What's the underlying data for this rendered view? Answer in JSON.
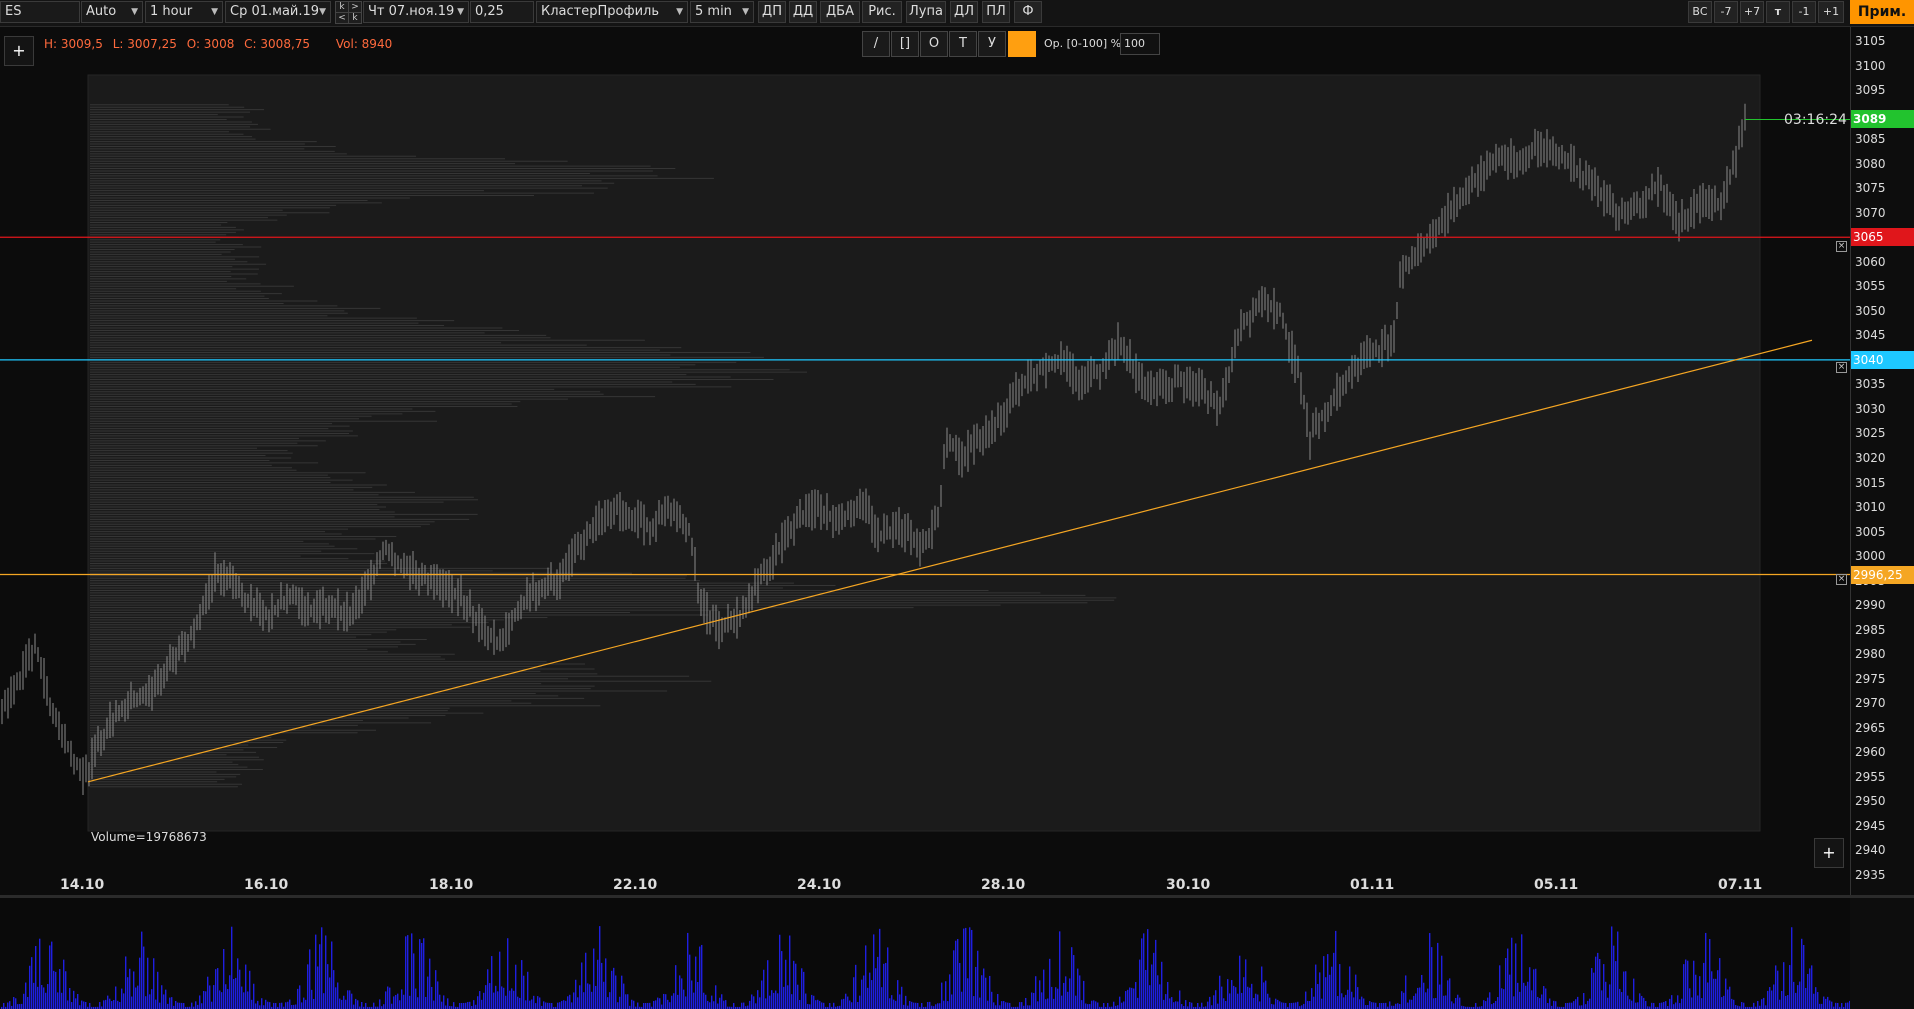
{
  "toolbar": {
    "symbol": "ES",
    "scale": "Auto",
    "timeframe": "1 hour",
    "date_from": "Ср 01.май.19",
    "date_to": "Чт 07.ноя.19",
    "step_top_left": "k",
    "step_top_right": ">",
    "step_bot_left": "<",
    "step_bot_right": "k",
    "tick": "0,25",
    "mode": "КластерПрофиль",
    "interval": "5 min",
    "buttons": [
      "ДП",
      "ДД",
      "ДБА",
      "Рис.",
      "Лупа",
      "ДЛ",
      "ПЛ",
      "Ф"
    ],
    "right_buttons": [
      "ВС",
      "-7",
      "+7",
      "т",
      "-1",
      "+1"
    ],
    "prim_label": "Прим."
  },
  "info": {
    "high": "H: 3009,5",
    "low": "L: 3007,25",
    "open": "O: 3008",
    "close": "C: 3008,75",
    "volume": "Vol: 8940"
  },
  "draw_tools": {
    "tools": [
      "/",
      "[]",
      "O",
      "T",
      "У"
    ],
    "color": "#ff9f10",
    "opacity_label": "Ор. [0-100] %:",
    "opacity_value": "100"
  },
  "profile_volume_label": "Volume=19768673",
  "timer": "03:16:24",
  "price_axis": {
    "labels": [
      "3105",
      "3100",
      "3095",
      "3090",
      "3085",
      "3080",
      "3075",
      "3070",
      "3065",
      "3060",
      "3055",
      "3050",
      "3045",
      "3040",
      "3035",
      "3030",
      "3025",
      "3020",
      "3015",
      "3010",
      "3005",
      "3000",
      "2995",
      "2990",
      "2985",
      "2980",
      "2975",
      "2970",
      "2965",
      "2960",
      "2955",
      "2950",
      "2945",
      "2940",
      "2935"
    ],
    "tags": [
      {
        "label": "3089",
        "bg": "#22c32e",
        "fg": "#ffffff"
      },
      {
        "label": "3065",
        "bg": "#e0161b",
        "fg": "#ffffff"
      },
      {
        "label": "3040",
        "bg": "#1ec8ff",
        "fg": "#ffffff"
      },
      {
        "label": "2996,25",
        "bg": "#f5a623",
        "fg": "#ffffff"
      }
    ]
  },
  "time_axis": [
    "14.10",
    "16.10",
    "18.10",
    "22.10",
    "24.10",
    "28.10",
    "30.10",
    "01.11",
    "05.11",
    "07.11"
  ],
  "colors": {
    "red_level": "#e0161b",
    "blue_level": "#1ec8ff",
    "orange_level": "#f5a623",
    "trendline": "#f5a623",
    "current_price": "#22c32e",
    "volume_bars": "#1f1fe0"
  },
  "chart_data": {
    "type": "bar",
    "series": [
      {
        "name": "ES",
        "values": []
      }
    ],
    "ylim": [
      2935,
      3105
    ]
  }
}
